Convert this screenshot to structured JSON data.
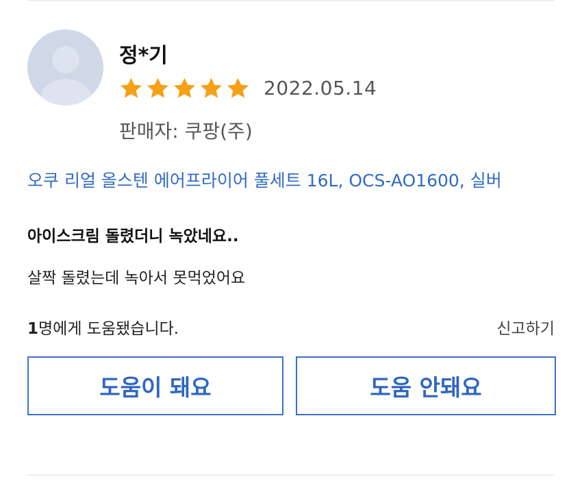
{
  "review": {
    "reviewer_name": "정*기",
    "rating": 5,
    "rating_max": 5,
    "date": "2022.05.14",
    "seller": "판매자: 쿠팡(주)",
    "product": "오쿠 리얼 올스텐 에어프라이어 풀세트 16L, OCS-AO1600, 실버",
    "headline": "아이스크림 돌렸더니 녹았네요..",
    "body": "살짝 돌렸는데 녹아서 못먹었어요"
  },
  "feedback": {
    "helpful_count": "1",
    "helpful_suffix": "명에게 도움됐습니다.",
    "report_label": "신고하기",
    "helpful_button": "도움이 돼요",
    "not_helpful_button": "도움 안돼요"
  },
  "icons": {
    "avatar": "user-avatar-placeholder-icon",
    "star": "star-filled-icon"
  },
  "colors": {
    "star": "#f5a017",
    "link": "#2f6bc4",
    "button_border": "#3b6fca",
    "avatar_bg": "#cfd8e6"
  }
}
